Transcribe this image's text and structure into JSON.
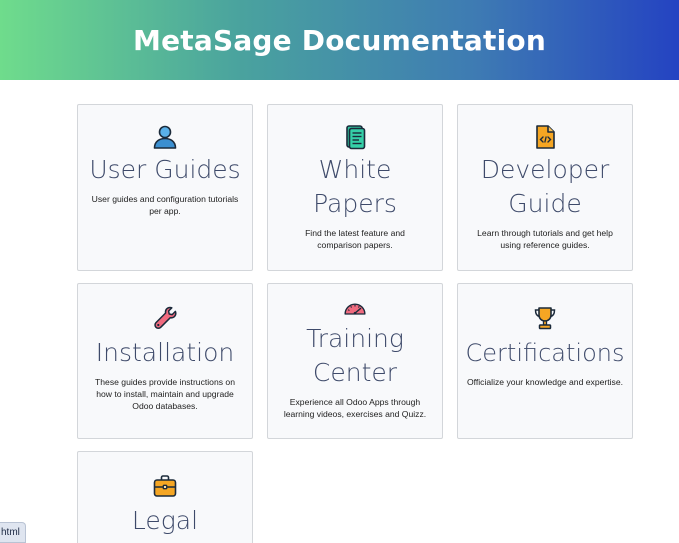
{
  "header": {
    "title": "MetaSage Documentation"
  },
  "cards": [
    {
      "icon": "user-icon",
      "title": "User Guides",
      "description": "User guides and configuration tutorials per app."
    },
    {
      "icon": "document-icon",
      "title": "White Papers",
      "description": "Find the latest feature and comparison papers."
    },
    {
      "icon": "code-file-icon",
      "title": "Developer Guide",
      "description": "Learn through tutorials and get help using reference guides."
    },
    {
      "icon": "wrench-icon",
      "title": "Installation",
      "description": "These guides provide instructions on how to install, maintain and upgrade Odoo databases."
    },
    {
      "icon": "speedometer-icon",
      "title": "Training Center",
      "description": "Experience all Odoo Apps through learning videos, exercises and Quizz."
    },
    {
      "icon": "trophy-icon",
      "title": "Certifications",
      "description": "Officialize your knowledge and expertise."
    },
    {
      "icon": "briefcase-icon",
      "title": "Legal",
      "description": ""
    }
  ],
  "badge": {
    "label": "html"
  },
  "colors": {
    "header_gradient_start": "#6fdc8c",
    "header_gradient_end": "#2443c2",
    "card_background": "#f8f9fb",
    "card_title": "#3e4a6a"
  }
}
